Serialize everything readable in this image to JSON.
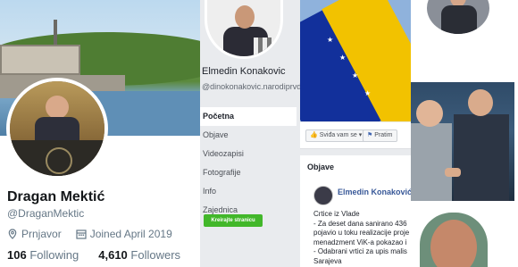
{
  "twitter": {
    "name": "Dragan Mektić",
    "handle": "@DraganMektic",
    "location": "Prnjavor",
    "joined": "Joined April 2019",
    "following_count": "106",
    "following_label": "Following",
    "followers_count": "4,610",
    "followers_label": "Followers"
  },
  "facebook_page": {
    "name": "Elmedin Konakovic",
    "handle": "@dinokonakovic.narodiprvda.ba",
    "nav": [
      "Početna",
      "Objave",
      "Videozapisi",
      "Fotografije",
      "Info",
      "Zajednica"
    ],
    "create_button": "Kreirajte stranicu"
  },
  "facebook_feed": {
    "like_button": "Sviđa vam se",
    "message_button": "Pratim",
    "section_title": "Objave",
    "post_author": "Elmedin Konaković",
    "post_lines": [
      "Crtice iz Vlade",
      "- Za deset dana sanirano 436",
      "pojavio u toku realizacije proje",
      "menadzment ViK-a pokazao i",
      "- Odabrani vrtici za upis malis",
      "Sarajeva"
    ]
  },
  "colors": {
    "twitter_text": "#14171a",
    "twitter_muted": "#657786",
    "fb_background": "#e9ebee",
    "fb_green": "#42b72a",
    "fb_link": "#385898"
  }
}
